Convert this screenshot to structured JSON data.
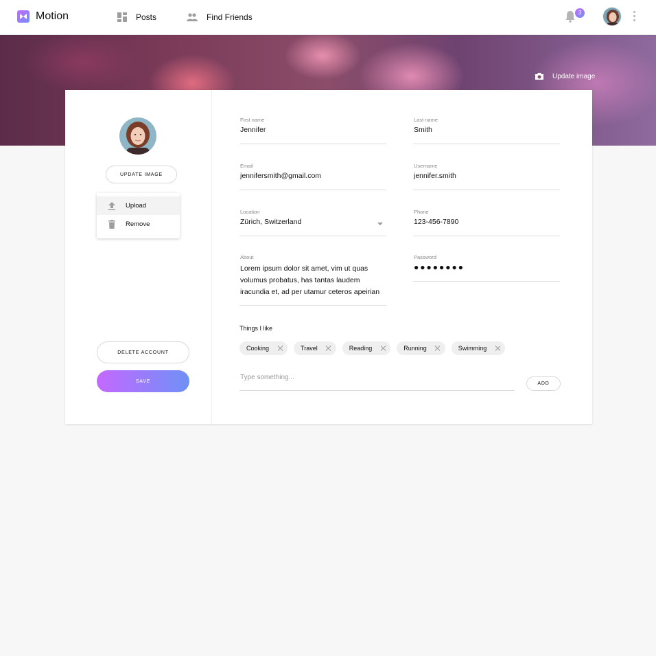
{
  "app": {
    "brand": "Motion"
  },
  "nav": {
    "items": [
      {
        "label": "Posts",
        "icon": "dashboard-icon"
      },
      {
        "label": "Find Friends",
        "icon": "people-icon"
      }
    ]
  },
  "notifications": {
    "count": "3"
  },
  "banner": {
    "update_image_label": "Update image"
  },
  "profile": {
    "update_image_button": "UPDATE IMAGE",
    "menu": [
      {
        "label": "Upload",
        "icon": "upload-icon"
      },
      {
        "label": "Remove",
        "icon": "trash-icon"
      }
    ],
    "delete_button": "DELETE ACCOUNT",
    "save_button": "SAVE"
  },
  "form": {
    "first_name": {
      "label": "First name",
      "value": "Jennifer"
    },
    "last_name": {
      "label": "Last name",
      "value": "Smith"
    },
    "email": {
      "label": "Email",
      "value": "jennifersmith@gmail.com"
    },
    "username": {
      "label": "Username",
      "value": "jennifer.smith"
    },
    "location": {
      "label": "Location",
      "value": "Zürich, Switzerland"
    },
    "phone": {
      "label": "Phone",
      "value": "123-456-7890"
    },
    "about": {
      "label": "About",
      "value": "Lorem ipsum dolor sit amet, vim ut quas volumus probatus, has tantas laudem iracundia et, ad per utamur ceteros apeirian"
    },
    "password": {
      "label": "Password",
      "value": "●●●●●●●●"
    }
  },
  "things": {
    "label": "Things I like",
    "tags": [
      "Cooking",
      "Travel",
      "Reading",
      "Running",
      "Swimming"
    ],
    "input_placeholder": "Type something...",
    "add_button": "ADD"
  },
  "colors": {
    "accent_start": "#c468ff",
    "accent_end": "#6e91f6"
  }
}
